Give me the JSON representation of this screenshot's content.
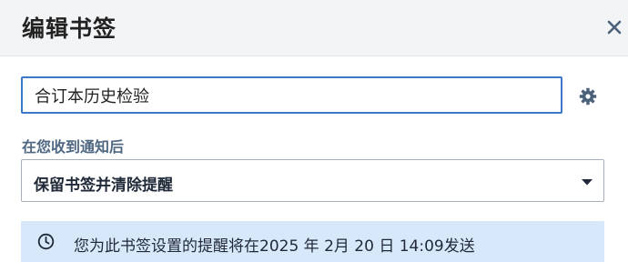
{
  "dialog": {
    "title": "编辑书签"
  },
  "icons": {
    "close": "close-icon",
    "settings": "gear-icon",
    "caret": "caret-down-icon",
    "clock": "clock-icon"
  },
  "name_field": {
    "value": "合订本历史检验"
  },
  "after_notify": {
    "label": "在您收到通知后",
    "selected_option": "保留书签并清除提醒"
  },
  "reminder_notice": {
    "text": "您为此书签设置的提醒将在2025 年 2月 20 日 14:09发送"
  },
  "colors": {
    "header_bg": "#f3f4f6",
    "input_focus_border": "#3b78c7",
    "label_text": "#506882",
    "notice_bg": "#d8e8fb",
    "icon_color": "#4a617a"
  }
}
